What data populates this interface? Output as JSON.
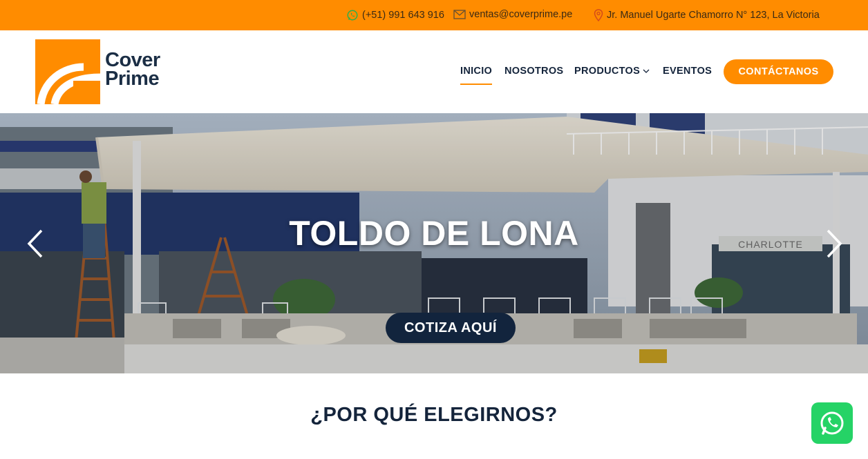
{
  "topbar": {
    "phone": "(+51) 991 643 916",
    "email": "ventas@coverprime.pe",
    "address": "Jr. Manuel Ugarte Chamorro N° 123, La Victoria",
    "icons": [
      "whatsapp-icon",
      "mail-icon",
      "location-pin-icon"
    ]
  },
  "brand": {
    "line1": "Cover",
    "line2": "Prime"
  },
  "nav": {
    "inicio": "INICIO",
    "nosotros": "NOSOTROS",
    "productos": "PRODUCTOS",
    "eventos": "EVENTOS",
    "cta": "CONTÁCTANOS",
    "active": "INICIO"
  },
  "hero": {
    "title": "TOLDO DE LONA",
    "button": "COTIZA AQUÍ",
    "sign_text": "CHARLOTTE"
  },
  "section": {
    "title": "¿POR QUÉ ELEGIRNOS?"
  },
  "colors": {
    "accent": "#ff8c00",
    "navy": "#14243b",
    "whatsapp": "#25d366"
  }
}
